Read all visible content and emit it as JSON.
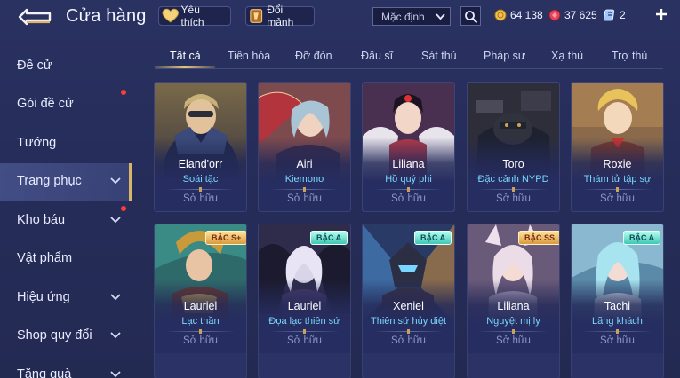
{
  "header": {
    "title": "Cửa hàng",
    "favorites_label": "Yêu thích",
    "fragments_label": "Đổi mảnh",
    "sort_selected": "Mặc định",
    "currencies": {
      "gold": "64 138",
      "ruby": "37 625",
      "tickets": "2"
    }
  },
  "sidebar": {
    "items": [
      {
        "label": "Đề cử"
      },
      {
        "label": "Gói đề cử"
      },
      {
        "label": "Tướng"
      },
      {
        "label": "Trang phục"
      },
      {
        "label": "Kho báu"
      },
      {
        "label": "Vật phẩm"
      },
      {
        "label": "Hiệu ứng"
      },
      {
        "label": "Shop quy đổi"
      },
      {
        "label": "Tặng quà"
      }
    ]
  },
  "tabs": [
    {
      "label": "Tất cả"
    },
    {
      "label": "Tiến hóa"
    },
    {
      "label": "Đỡ đòn"
    },
    {
      "label": "Đấu sĩ"
    },
    {
      "label": "Sát thủ"
    },
    {
      "label": "Pháp sư"
    },
    {
      "label": "Xạ thủ"
    },
    {
      "label": "Trợ thủ"
    }
  ],
  "skins": [
    {
      "hero": "Eland'orr",
      "skin": "Soái tặc",
      "status": "Sở hữu",
      "badge": ""
    },
    {
      "hero": "Airi",
      "skin": "Kiemono",
      "status": "Sở hữu",
      "badge": ""
    },
    {
      "hero": "Liliana",
      "skin": "Hồ quý phi",
      "status": "Sở hữu",
      "badge": ""
    },
    {
      "hero": "Toro",
      "skin": "Đặc cảnh NYPD",
      "status": "Sở hữu",
      "badge": ""
    },
    {
      "hero": "Roxie",
      "skin": "Thám tử tập sự",
      "status": "Sở hữu",
      "badge": ""
    },
    {
      "hero": "Lauriel",
      "skin": "Lạc thần",
      "status": "Sở hữu",
      "badge": "BẬC S+"
    },
    {
      "hero": "Lauriel",
      "skin": "Đọa lạc thiên sứ",
      "status": "Sở hữu",
      "badge": "BẬC A"
    },
    {
      "hero": "Xeniel",
      "skin": "Thiên sứ hủy diệt",
      "status": "Sở hữu",
      "badge": "BẬC A"
    },
    {
      "hero": "Liliana",
      "skin": "Nguyệt mị ly",
      "status": "Sở hữu",
      "badge": "BẬC SS"
    },
    {
      "hero": "Tachi",
      "skin": "Lãng khách",
      "status": "Sở hữu",
      "badge": "BẬC A"
    }
  ],
  "colors": {
    "background": "#262d5a",
    "accent_gold": "#e8c478",
    "skin_name": "#79d7ff",
    "notification": "#ff3b3b"
  },
  "icons": [
    "back-arrow-icon",
    "heart-icon",
    "fragment-icon",
    "chevron-down-icon",
    "search-icon",
    "gold-coin-icon",
    "ruby-icon",
    "ticket-icon",
    "plus-icon"
  ]
}
